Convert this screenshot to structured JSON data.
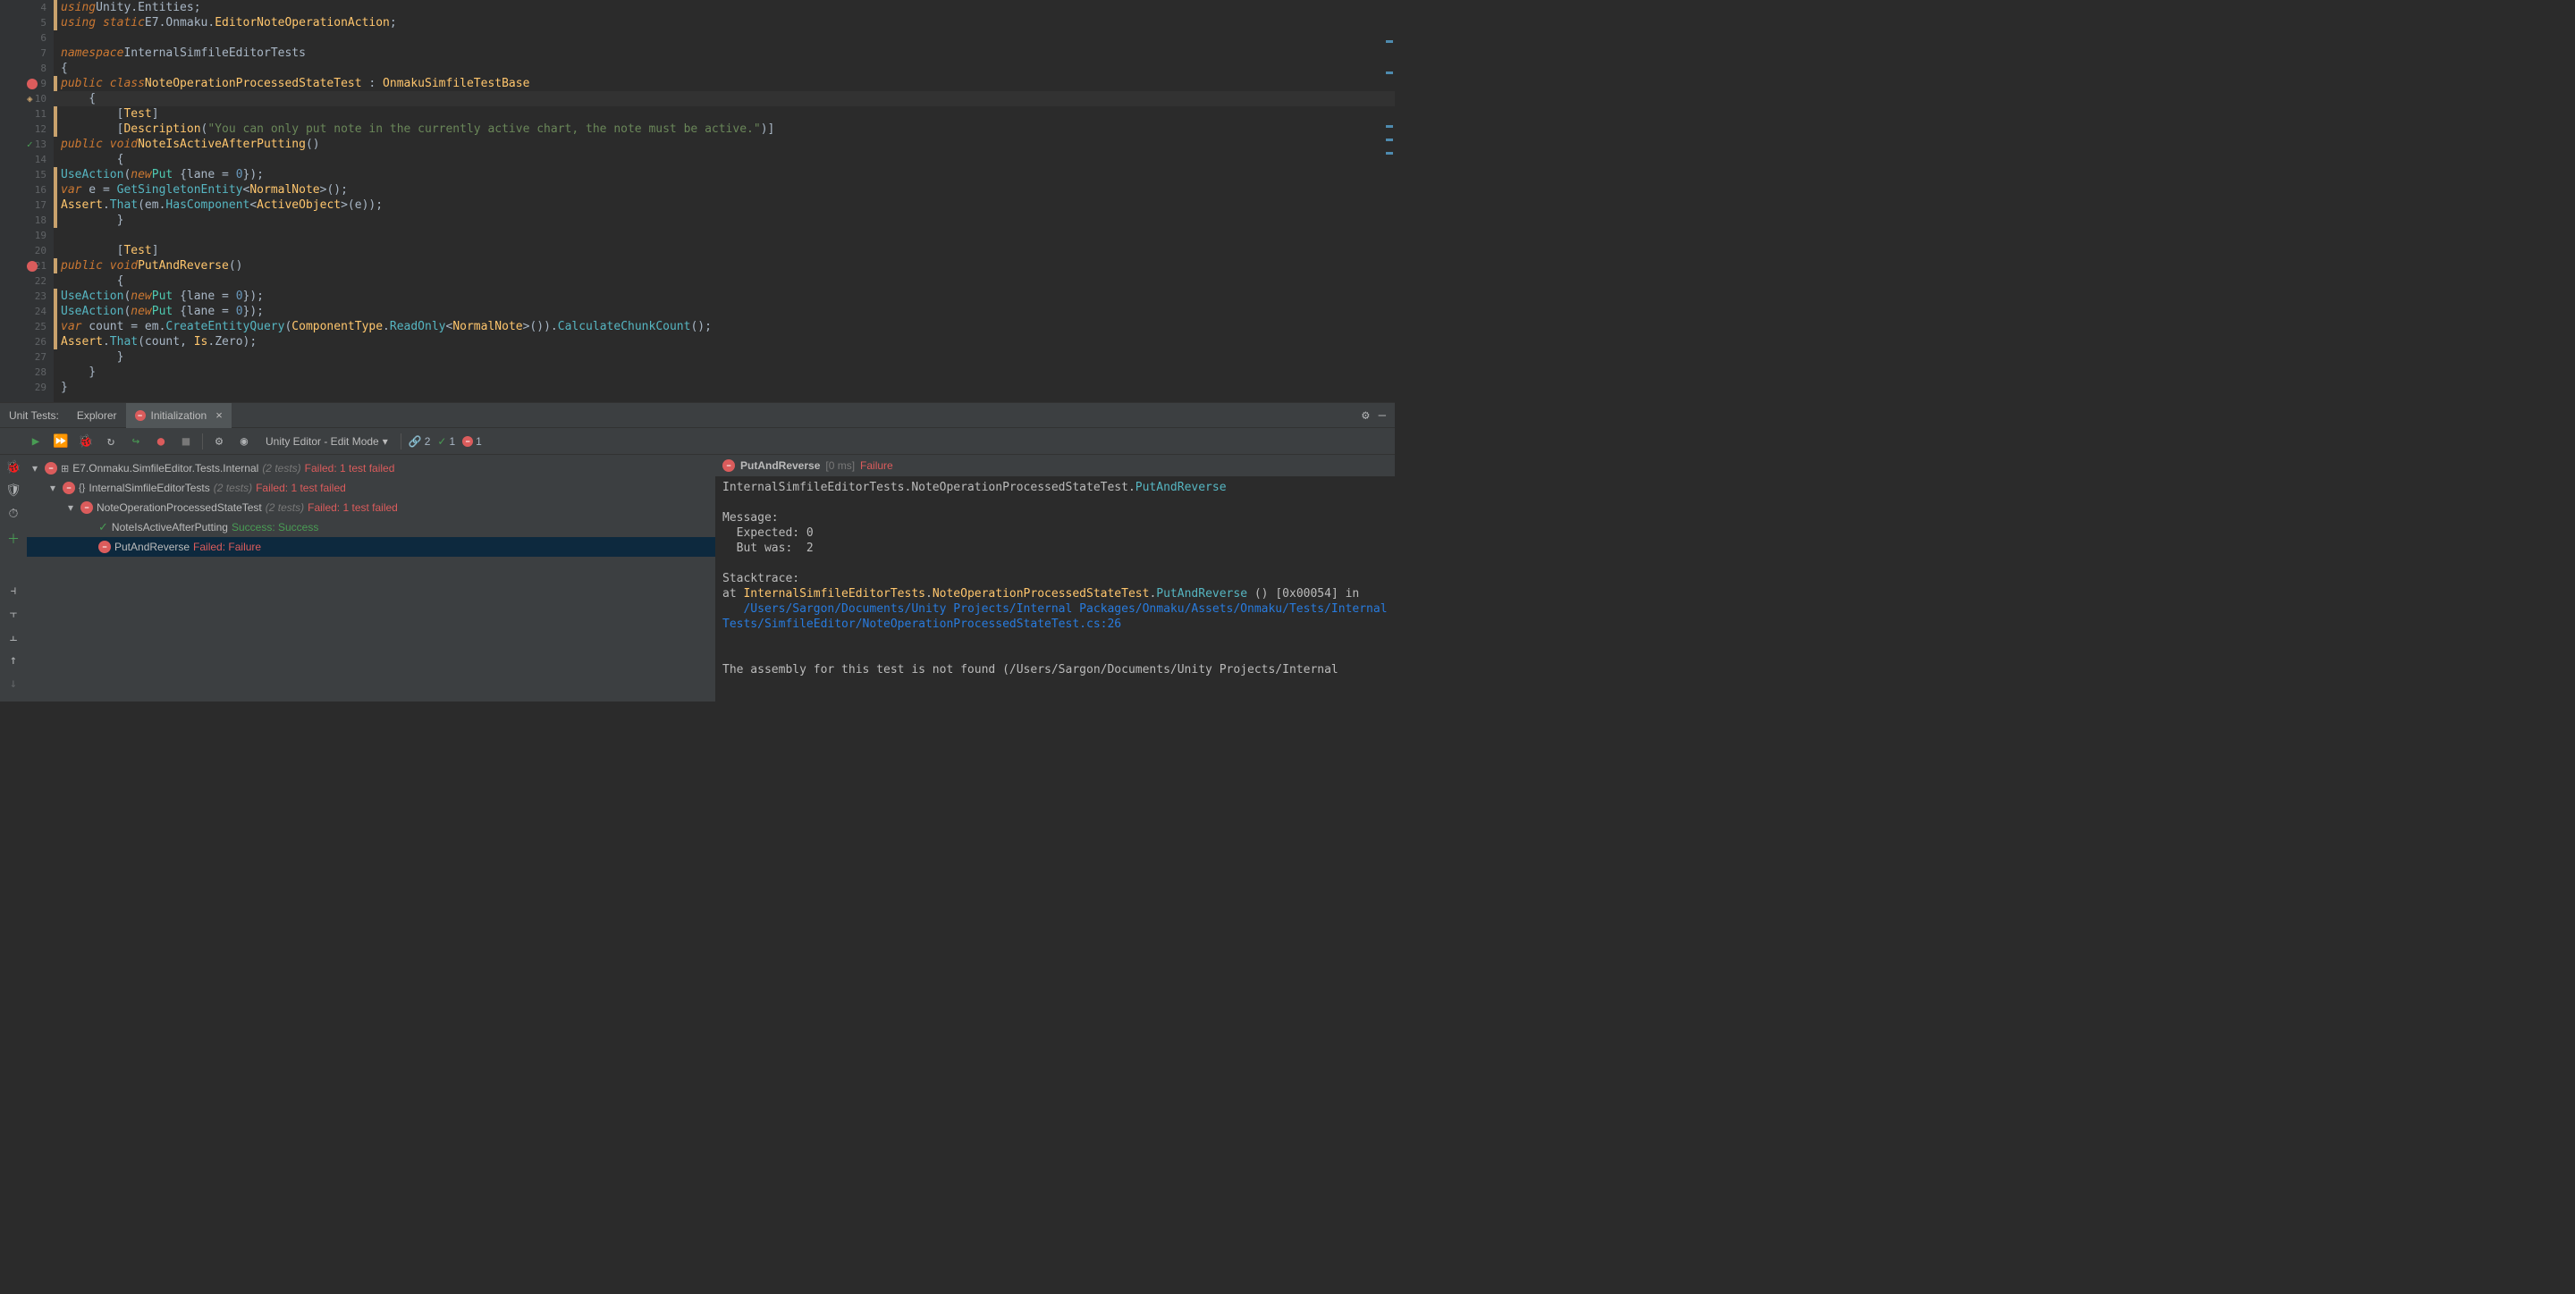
{
  "editor": {
    "lines": {
      "4": "using Unity.Entities;",
      "5": "using static E7.Onmaku.EditorNoteOperationAction;",
      "7": "namespace InternalSimfileEditorTests",
      "8": "{",
      "9": "    public class NoteOperationProcessedStateTest : OnmakuSimfileTestBase",
      "10": "    {",
      "11": "        [Test]",
      "12": "        [Description(\"You can only put note in the currently active chart, the note must be active.\")]",
      "13": "        public void NoteIsActiveAfterPutting()",
      "14": "        {",
      "15": "            UseAction(new Put {lane = 0});",
      "16": "            var e = GetSingletonEntity<NormalNote>();",
      "17": "            Assert.That(em.HasComponent<ActiveObject>(e));",
      "18": "        }",
      "20": "        [Test]",
      "21": "        public void PutAndReverse()",
      "22": "        {",
      "23": "            UseAction(new Put {lane = 0});",
      "24": "            UseAction(new Put {lane = 0});",
      "25": "            var count = em.CreateEntityQuery(ComponentType.ReadOnly<NormalNote>()).CalculateChunkCount();",
      "26": "            Assert.That(count, Is.Zero);",
      "27": "        }",
      "28": "    }",
      "29": "}"
    }
  },
  "panel": {
    "tabsLabel": "Unit Tests:",
    "explorerTab": "Explorer",
    "activeTab": "Initialization",
    "closeX": "×"
  },
  "toolbar": {
    "mode": "Unity Editor - Edit Mode",
    "linkCount": "2",
    "passCount": "1",
    "failCount": "1"
  },
  "tree": {
    "root": {
      "name": "E7.Onmaku.SimfileEditor.Tests.Internal",
      "count": "(2 tests)",
      "status": "Failed: 1 test failed"
    },
    "ns": {
      "name": "InternalSimfileEditorTests",
      "count": "(2 tests)",
      "status": "Failed: 1 test failed"
    },
    "class": {
      "name": "NoteOperationProcessedStateTest",
      "count": "(2 tests)",
      "status": "Failed: 1 test failed"
    },
    "test1": {
      "name": "NoteIsActiveAfterPutting",
      "status": "Success: Success"
    },
    "test2": {
      "name": "PutAndReverse",
      "status": "Failed: Failure"
    }
  },
  "detail": {
    "title": "PutAndReverse",
    "time": "[0 ms]",
    "result": "Failure",
    "qname_ns": "InternalSimfileEditorTests.NoteOperationProcessedStateTest.",
    "qname_method": "PutAndReverse",
    "messageLabel": "Message:",
    "expected": "  Expected: 0",
    "butwas": "  But was:  2",
    "stackLabel": "Stacktrace:",
    "stack_at": "at ",
    "stack_q1": "InternalSimfileEditorTests",
    "stack_dot": ".",
    "stack_q2": "NoteOperationProcessedStateTest",
    "stack_q3": "PutAndReverse",
    "stack_tail": " () [0x00054] in",
    "stack_path": "/Users/Sargon/Documents/Unity Projects/Internal Packages/Onmaku/Assets/Onmaku/Tests/InternalTests/SimfileEditor/NoteOperationProcessedStateTest.cs:26",
    "assembly": "The assembly for this test is not found (/Users/Sargon/Documents/Unity Projects/Internal"
  }
}
